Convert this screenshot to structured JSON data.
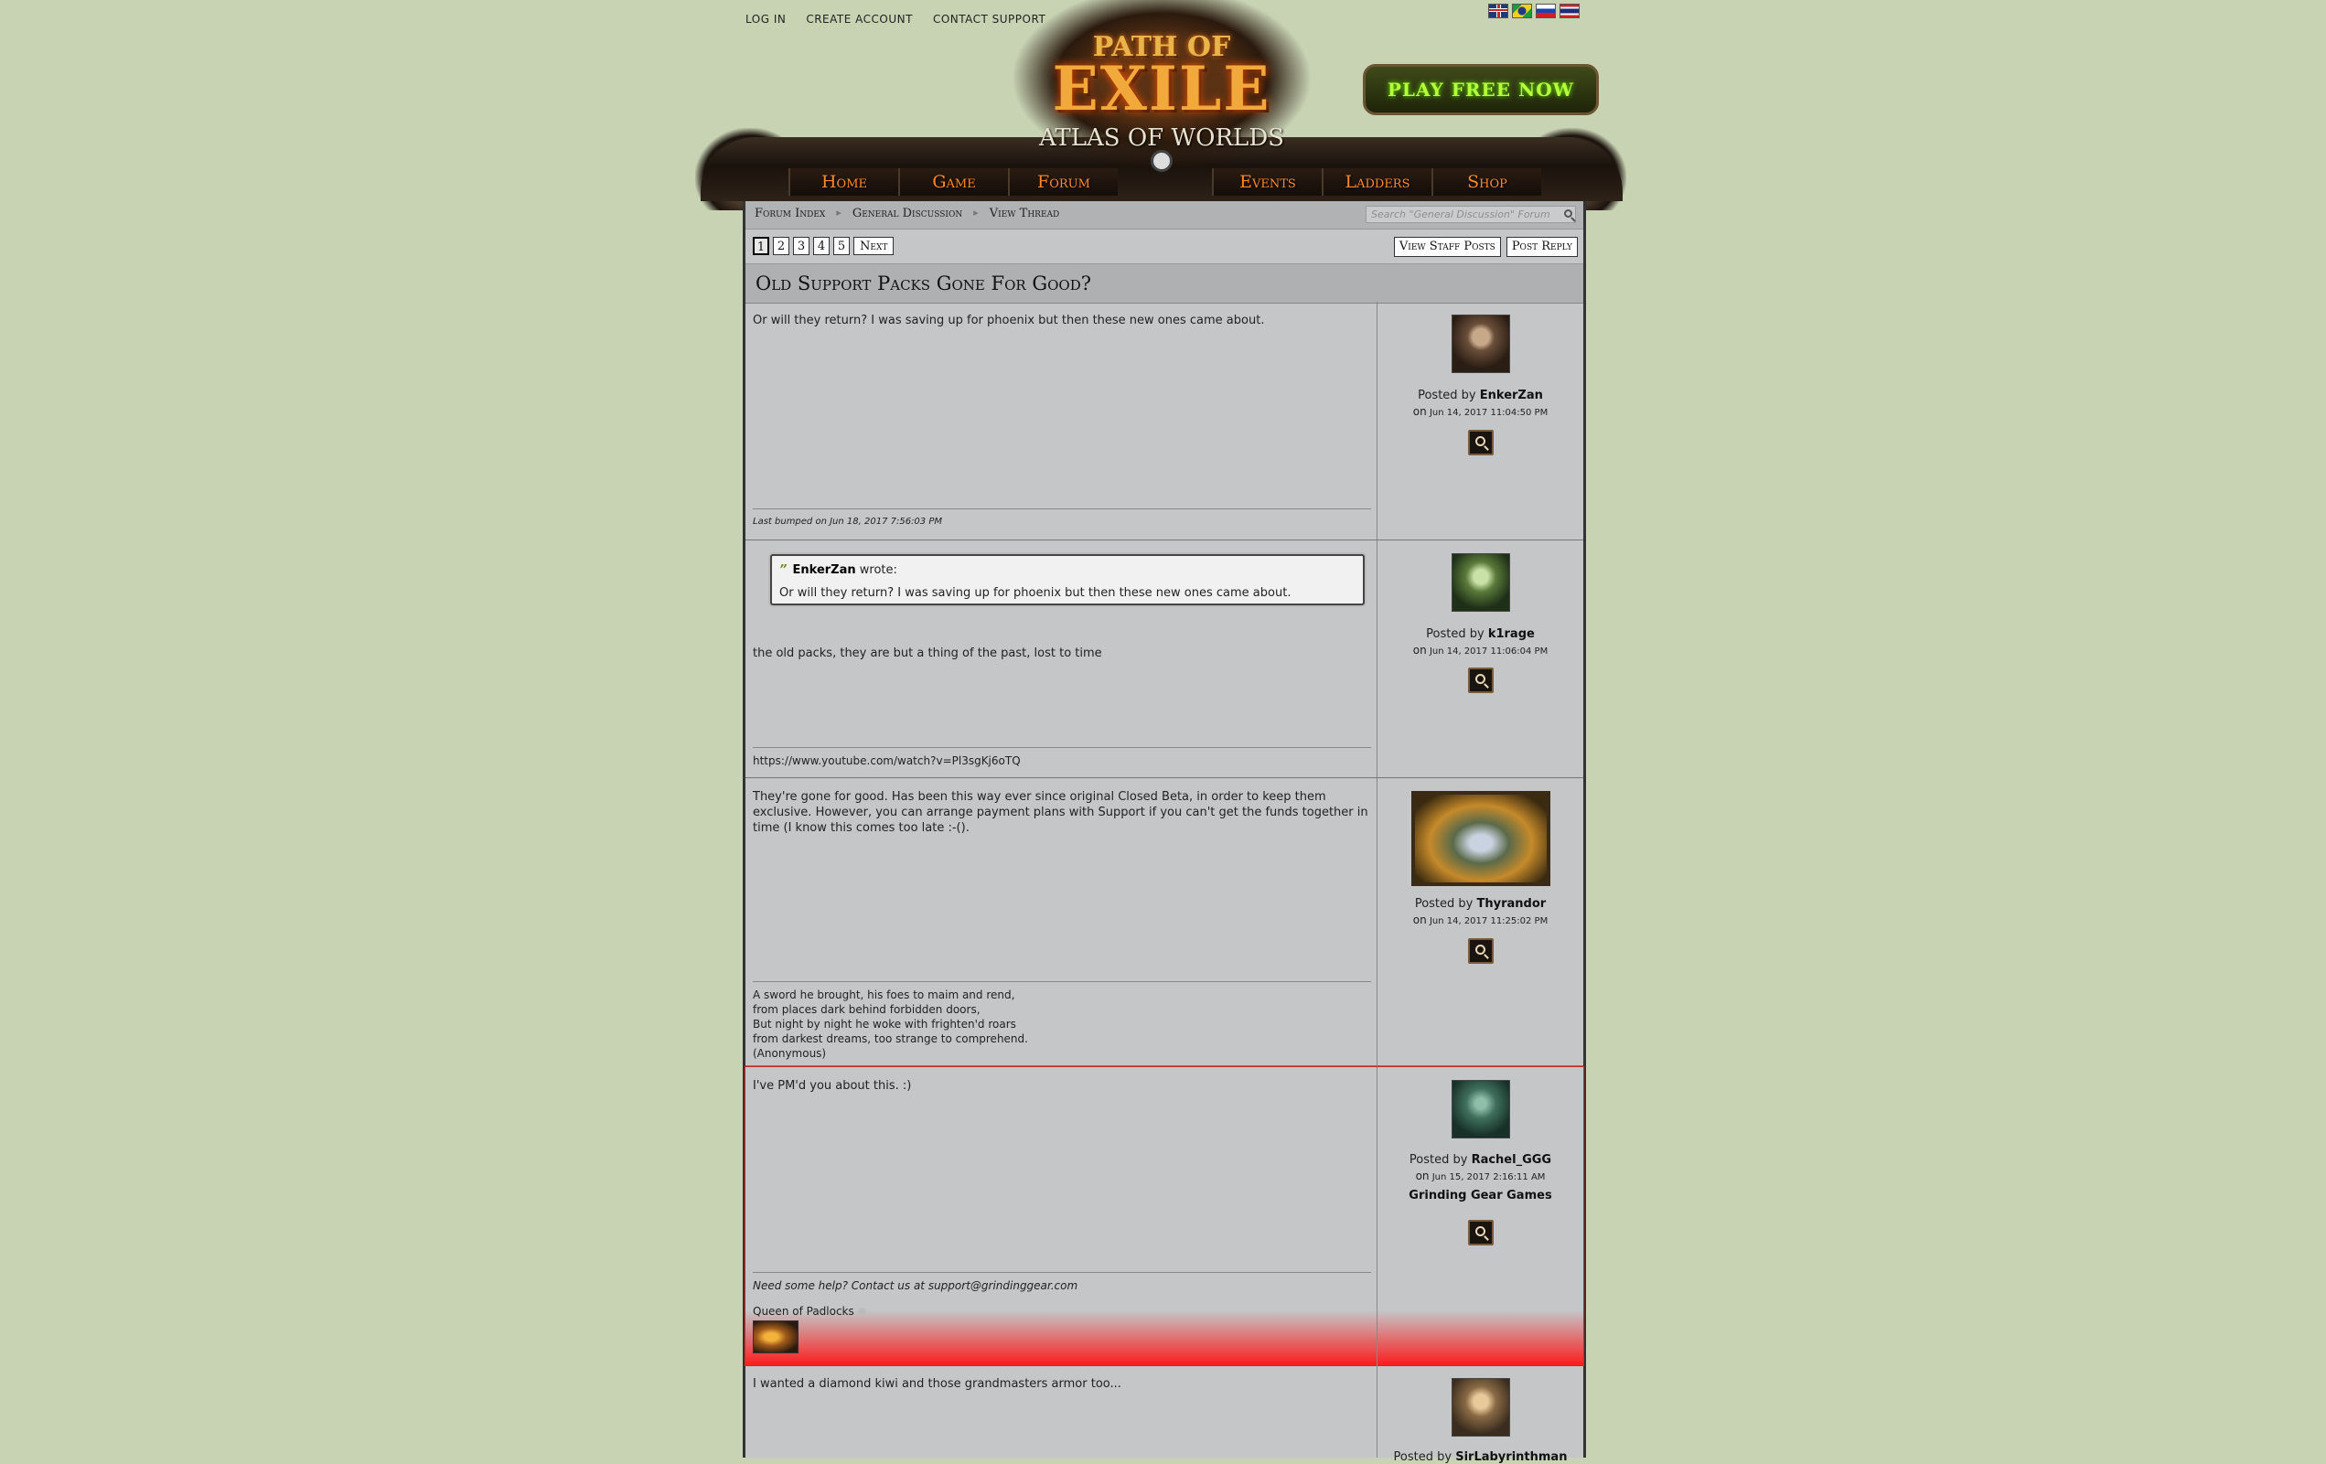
{
  "top_links": [
    "LOG IN",
    "CREATE ACCOUNT",
    "CONTACT SUPPORT"
  ],
  "logo": {
    "line1": "PATH OF",
    "line2": "EXILE",
    "line3": "ATLAS OF WORLDS"
  },
  "play_button": "PLAY FREE NOW",
  "nav": {
    "left": [
      "Home",
      "Game",
      "Forum"
    ],
    "right": [
      "Events",
      "Ladders",
      "Shop"
    ]
  },
  "breadcrumb": [
    "Forum Index",
    "General Discussion",
    "View Thread"
  ],
  "search": {
    "placeholder": "Search \"General Discussion\" Forum"
  },
  "pager": {
    "pages": [
      "1",
      "2",
      "3",
      "4",
      "5"
    ],
    "next": "Next",
    "current": "1"
  },
  "actions": {
    "staff_posts": "View Staff Posts",
    "reply": "Post Reply"
  },
  "thread_title": "Old Support Packs Gone For Good?",
  "posts": [
    {
      "text": "Or will they return? I was saving up for phoenix but then these new ones came about.",
      "signature": "Last bumped on Jun 18, 2017 7:56:03 PM",
      "posted_by_prefix": "Posted by",
      "author": "EnkerZan",
      "on_prefix": "on",
      "date": "Jun 14, 2017 11:04:50 PM"
    },
    {
      "quote": {
        "author": "EnkerZan",
        "wrote": "wrote:",
        "text": "Or will they return? I was saving up for phoenix but then these new ones came about."
      },
      "text": "the old packs, they are but a thing of the past, lost to time",
      "signature": "https://www.youtube.com/watch?v=Pl3sgKj6oTQ",
      "posted_by_prefix": "Posted by",
      "author": "k1rage",
      "on_prefix": "on",
      "date": "Jun 14, 2017 11:06:04 PM"
    },
    {
      "text": "They're gone for good. Has been this way ever since original Closed Beta, in order to keep them exclusive. However, you can arrange payment plans with Support if you can't get the funds together in time (I know this comes too late :-().",
      "signature_lines": [
        "A sword he brought, his foes to maim and rend,",
        "from places dark behind forbidden doors,",
        "But night by night he woke with frighten'd roars",
        "from darkest dreams, too strange to comprehend.",
        "(Anonymous)"
      ],
      "posted_by_prefix": "Posted by",
      "author": "Thyrandor",
      "on_prefix": "on",
      "date": "Jun 14, 2017 11:25:02 PM"
    },
    {
      "text": "I've PM'd you about this. :)",
      "signature": "Need some help? Contact us at support@grindinggear.com",
      "signature2": "Queen of Padlocks",
      "posted_by_prefix": "Posted by",
      "author": "Rachel_GGG",
      "on_prefix": "on",
      "date": "Jun 15, 2017 2:16:11 AM",
      "org": "Grinding Gear Games"
    },
    {
      "text": "I wanted a diamond kiwi and those grandmasters armor too...",
      "posted_by_prefix": "Posted by",
      "author": "SirLabyrinthman"
    }
  ]
}
